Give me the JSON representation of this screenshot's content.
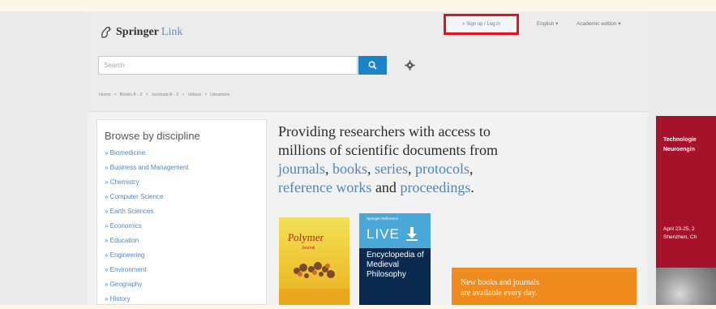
{
  "header": {
    "logo_springer": "Springer",
    "logo_link": "Link",
    "signup_label": "» Sign up / Log in",
    "language": "English ▾",
    "edition": "Academic edition ▾"
  },
  "search": {
    "placeholder": "Search"
  },
  "breadcrumb": [
    "Home",
    "•",
    "Books A - Z",
    "•",
    "Journals A - Z",
    "•",
    "Videos",
    "•",
    "Librarians"
  ],
  "browse": {
    "title": "Browse by discipline",
    "items": [
      "» Biomedicine",
      "» Business and Management",
      "» Chemistry",
      "» Computer Science",
      "» Earth Sciences",
      "» Economics",
      "» Education",
      "» Engineering",
      "» Environment",
      "» Geography",
      "» History"
    ]
  },
  "headline": {
    "line1": "Providing researchers with access to",
    "line2": "millions of scientific documents from",
    "kw_journals": "journals",
    "sep1": ", ",
    "kw_books": "books",
    "sep2": ", ",
    "kw_series": "series",
    "sep3": ", ",
    "kw_protocols": "protocols",
    "sep4": ",",
    "kw_reference": "reference works",
    "and": " and ",
    "kw_proceedings": "proceedings",
    "end": "."
  },
  "books": {
    "book1_title": "Polymer",
    "book1_sub": "Journal",
    "book2_brand": "Springer Reference",
    "book2_live": "LIVE",
    "book2_title": "Encyclopedia of Medieval Philosophy"
  },
  "promo": {
    "line1": "New books and journals",
    "line2": "are available every day."
  },
  "ad": {
    "title1": "Technologie",
    "title2": "Neuroengin",
    "date1": "April 23-25, 2",
    "date2": "Shenzhen, Ch"
  },
  "colors": {
    "accent": "#1a84c6",
    "link": "#5a86b5",
    "highlight_border": "#e0151c",
    "promo": "#f08b1d",
    "ad": "#a5122a"
  }
}
